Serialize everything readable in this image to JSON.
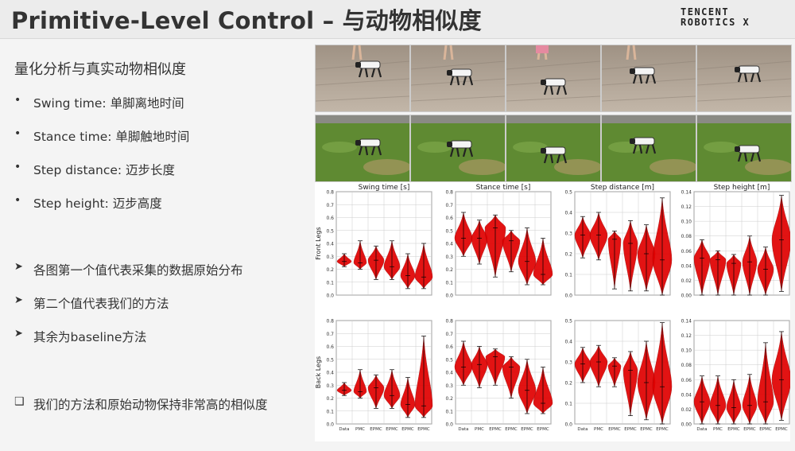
{
  "title": "Primitive-Level Control – 与动物相似度",
  "logo": {
    "line1": "TENCENT",
    "line2": "ROBOTICS X"
  },
  "subtitle": "量化分析与真实动物相似度",
  "metrics": [
    {
      "bullet": "•",
      "text": "Swing time: 单脚离地时间"
    },
    {
      "bullet": "•",
      "text": "Stance time: 单脚触地时间"
    },
    {
      "bullet": "•",
      "text": "Step distance: 迈步长度"
    },
    {
      "bullet": "•",
      "text": "Step height: 迈步高度"
    }
  ],
  "notes": [
    {
      "bullet": "➤",
      "text": "各图第一个值代表采集的数据原始分布"
    },
    {
      "bullet": "➤",
      "text": "第二个值代表我们的方法"
    },
    {
      "bullet": "➤",
      "text": "其余为baseline方法"
    }
  ],
  "conclusion": {
    "bullet": "❑",
    "text": "我们的方法和原始动物保持非常高的相似度"
  },
  "photos": {
    "rows": [
      {
        "name": "indoor-floor",
        "ground": "#a8998a",
        "robot": "#f2f2f2"
      },
      {
        "name": "outdoor-grass",
        "ground": "#6e9a3a",
        "robot": "#f2f2f2"
      }
    ]
  },
  "colors": {
    "violin": "#e00000",
    "grid": "#cccccc",
    "axis": "#555555"
  },
  "chart_data": [
    {
      "type": "violin",
      "title": "Swing time [s]",
      "ylabel": "Front Legs",
      "ylim": [
        0,
        0.8
      ],
      "yticks": [
        "0.0",
        "0.1",
        "0.2",
        "0.3",
        "0.4",
        "0.5",
        "0.6",
        "0.7",
        "0.8"
      ],
      "categories": [
        "Data",
        "PMC",
        "EPMC",
        "EPMC",
        "EPMC",
        "EPMC"
      ],
      "values": [
        {
          "min": 0.22,
          "med": 0.26,
          "max": 0.32,
          "w": 0.45
        },
        {
          "min": 0.2,
          "med": 0.25,
          "max": 0.42,
          "w": 0.4
        },
        {
          "min": 0.12,
          "med": 0.27,
          "max": 0.38,
          "w": 0.5
        },
        {
          "min": 0.12,
          "med": 0.22,
          "max": 0.42,
          "w": 0.5
        },
        {
          "min": 0.05,
          "med": 0.15,
          "max": 0.32,
          "w": 0.45
        },
        {
          "min": 0.05,
          "med": 0.14,
          "max": 0.4,
          "w": 0.55
        }
      ]
    },
    {
      "type": "violin",
      "title": "Stance time [s]",
      "ylabel": "",
      "ylim": [
        0,
        0.8
      ],
      "yticks": [
        "0.0",
        "0.1",
        "0.2",
        "0.3",
        "0.4",
        "0.5",
        "0.6",
        "0.7",
        "0.8"
      ],
      "categories": [
        "Data",
        "PMC",
        "EPMC",
        "EPMC",
        "EPMC",
        "EPMC"
      ],
      "values": [
        {
          "min": 0.3,
          "med": 0.44,
          "max": 0.64,
          "w": 0.55
        },
        {
          "min": 0.24,
          "med": 0.44,
          "max": 0.58,
          "w": 0.5
        },
        {
          "min": 0.14,
          "med": 0.52,
          "max": 0.62,
          "w": 0.65
        },
        {
          "min": 0.18,
          "med": 0.42,
          "max": 0.5,
          "w": 0.55
        },
        {
          "min": 0.08,
          "med": 0.26,
          "max": 0.52,
          "w": 0.55
        },
        {
          "min": 0.08,
          "med": 0.16,
          "max": 0.44,
          "w": 0.6
        }
      ]
    },
    {
      "type": "violin",
      "title": "Step distance [m]",
      "ylabel": "",
      "ylim": [
        0,
        0.5
      ],
      "yticks": [
        "0.0",
        "0.1",
        "0.2",
        "0.3",
        "0.4",
        "0.5"
      ],
      "categories": [
        "Data",
        "PMC",
        "EPMC",
        "EPMC",
        "EPMC",
        "EPMC"
      ],
      "values": [
        {
          "min": 0.18,
          "med": 0.29,
          "max": 0.38,
          "w": 0.5
        },
        {
          "min": 0.17,
          "med": 0.29,
          "max": 0.4,
          "w": 0.55
        },
        {
          "min": 0.03,
          "med": 0.27,
          "max": 0.31,
          "w": 0.4
        },
        {
          "min": 0.02,
          "med": 0.25,
          "max": 0.36,
          "w": 0.45
        },
        {
          "min": 0.02,
          "med": 0.2,
          "max": 0.34,
          "w": 0.55
        },
        {
          "min": 0.0,
          "med": 0.17,
          "max": 0.47,
          "w": 0.6
        }
      ]
    },
    {
      "type": "violin",
      "title": "Step height [m]",
      "ylabel": "",
      "ylim": [
        0,
        0.14
      ],
      "yticks": [
        "0.00",
        "0.02",
        "0.04",
        "0.06",
        "0.08",
        "0.10",
        "0.12",
        "0.14"
      ],
      "categories": [
        "Data",
        "PMC",
        "EPMC",
        "EPMC",
        "EPMC",
        "EPMC"
      ],
      "values": [
        {
          "min": 0.0,
          "med": 0.05,
          "max": 0.075,
          "w": 0.5
        },
        {
          "min": 0.0,
          "med": 0.048,
          "max": 0.06,
          "w": 0.5
        },
        {
          "min": 0.0,
          "med": 0.043,
          "max": 0.055,
          "w": 0.45
        },
        {
          "min": 0.0,
          "med": 0.045,
          "max": 0.08,
          "w": 0.45
        },
        {
          "min": 0.0,
          "med": 0.035,
          "max": 0.065,
          "w": 0.5
        },
        {
          "min": 0.005,
          "med": 0.075,
          "max": 0.135,
          "w": 0.6
        }
      ]
    },
    {
      "type": "violin",
      "title": "",
      "ylabel": "Back Legs",
      "ylim": [
        0,
        0.8
      ],
      "yticks": [
        "0.0",
        "0.1",
        "0.2",
        "0.3",
        "0.4",
        "0.5",
        "0.6",
        "0.7",
        "0.8"
      ],
      "categories": [
        "Data",
        "PMC",
        "EPMC",
        "EPMC",
        "EPMC",
        "EPMC"
      ],
      "values": [
        {
          "min": 0.22,
          "med": 0.26,
          "max": 0.32,
          "w": 0.45
        },
        {
          "min": 0.2,
          "med": 0.25,
          "max": 0.42,
          "w": 0.4
        },
        {
          "min": 0.12,
          "med": 0.28,
          "max": 0.38,
          "w": 0.5
        },
        {
          "min": 0.12,
          "med": 0.22,
          "max": 0.42,
          "w": 0.5
        },
        {
          "min": 0.05,
          "med": 0.15,
          "max": 0.36,
          "w": 0.45
        },
        {
          "min": 0.05,
          "med": 0.14,
          "max": 0.68,
          "w": 0.55
        }
      ]
    },
    {
      "type": "violin",
      "title": "",
      "ylabel": "",
      "ylim": [
        0,
        0.8
      ],
      "yticks": [
        "0.0",
        "0.1",
        "0.2",
        "0.3",
        "0.4",
        "0.5",
        "0.6",
        "0.7",
        "0.8"
      ],
      "categories": [
        "Data",
        "PMC",
        "EPMC",
        "EPMC",
        "EPMC",
        "EPMC"
      ],
      "values": [
        {
          "min": 0.3,
          "med": 0.44,
          "max": 0.64,
          "w": 0.55
        },
        {
          "min": 0.28,
          "med": 0.46,
          "max": 0.6,
          "w": 0.5
        },
        {
          "min": 0.3,
          "med": 0.52,
          "max": 0.58,
          "w": 0.6
        },
        {
          "min": 0.2,
          "med": 0.44,
          "max": 0.52,
          "w": 0.55
        },
        {
          "min": 0.08,
          "med": 0.26,
          "max": 0.5,
          "w": 0.55
        },
        {
          "min": 0.08,
          "med": 0.16,
          "max": 0.44,
          "w": 0.6
        }
      ]
    },
    {
      "type": "violin",
      "title": "",
      "ylabel": "",
      "ylim": [
        0,
        0.5
      ],
      "yticks": [
        "0.0",
        "0.1",
        "0.2",
        "0.3",
        "0.4",
        "0.5"
      ],
      "categories": [
        "Data",
        "PMC",
        "EPMC",
        "EPMC",
        "EPMC",
        "EPMC"
      ],
      "values": [
        {
          "min": 0.2,
          "med": 0.29,
          "max": 0.37,
          "w": 0.5
        },
        {
          "min": 0.18,
          "med": 0.3,
          "max": 0.38,
          "w": 0.55
        },
        {
          "min": 0.18,
          "med": 0.28,
          "max": 0.32,
          "w": 0.4
        },
        {
          "min": 0.04,
          "med": 0.26,
          "max": 0.35,
          "w": 0.45
        },
        {
          "min": 0.02,
          "med": 0.2,
          "max": 0.4,
          "w": 0.55
        },
        {
          "min": 0.0,
          "med": 0.18,
          "max": 0.49,
          "w": 0.6
        }
      ]
    },
    {
      "type": "violin",
      "title": "",
      "ylabel": "",
      "ylim": [
        0,
        0.14
      ],
      "yticks": [
        "0.00",
        "0.02",
        "0.04",
        "0.06",
        "0.08",
        "0.10",
        "0.12",
        "0.14"
      ],
      "categories": [
        "Data",
        "PMC",
        "EPMC",
        "EPMC",
        "EPMC",
        "EPMC"
      ],
      "values": [
        {
          "min": 0.0,
          "med": 0.03,
          "max": 0.065,
          "w": 0.5
        },
        {
          "min": 0.0,
          "med": 0.025,
          "max": 0.065,
          "w": 0.5
        },
        {
          "min": 0.0,
          "med": 0.022,
          "max": 0.06,
          "w": 0.45
        },
        {
          "min": 0.0,
          "med": 0.025,
          "max": 0.067,
          "w": 0.45
        },
        {
          "min": 0.0,
          "med": 0.03,
          "max": 0.11,
          "w": 0.5
        },
        {
          "min": 0.005,
          "med": 0.06,
          "max": 0.125,
          "w": 0.6
        }
      ]
    }
  ]
}
